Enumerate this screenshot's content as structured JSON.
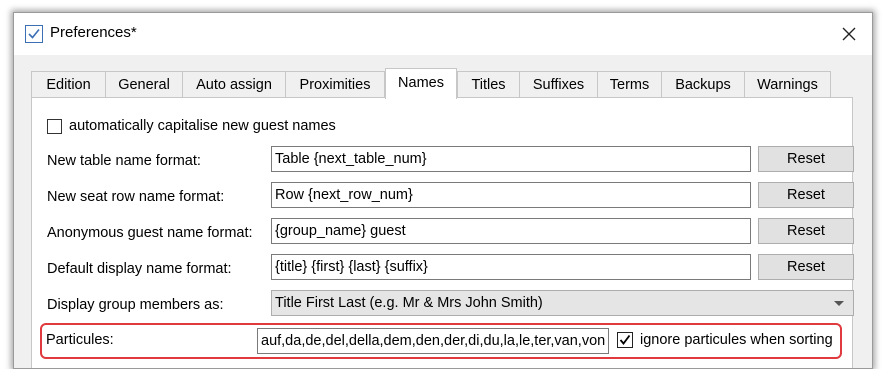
{
  "window": {
    "title": "Preferences*"
  },
  "tabs": [
    {
      "label": "Edition"
    },
    {
      "label": "General"
    },
    {
      "label": "Auto assign"
    },
    {
      "label": "Proximities"
    },
    {
      "label": "Names",
      "active": true
    },
    {
      "label": "Titles"
    },
    {
      "label": "Suffixes"
    },
    {
      "label": "Terms"
    },
    {
      "label": "Backups"
    },
    {
      "label": "Warnings"
    }
  ],
  "names": {
    "capitalise_label": "automatically capitalise new guest names",
    "capitalise_checked": false,
    "rows": [
      {
        "label": "New table name format:",
        "value": "Table {next_table_num}",
        "button": "Reset"
      },
      {
        "label": "New seat row name format:",
        "value": "Row {next_row_num}",
        "button": "Reset"
      },
      {
        "label": "Anonymous guest name format:",
        "value": "{group_name} guest",
        "button": "Reset"
      },
      {
        "label": "Default display name format:",
        "value": "{title} {first} {last} {suffix}",
        "button": "Reset"
      }
    ],
    "display_group_label": "Display group members as:",
    "display_group_value": "Title First Last (e.g. Mr & Mrs John Smith)",
    "particules_label": "Particules:",
    "particules_value": "auf,da,de,del,della,dem,den,der,di,du,la,le,ter,van,von",
    "ignore_label": "ignore particules when sorting",
    "ignore_checked": true
  },
  "colors": {
    "highlight": "#e0393e",
    "icon_blue": "#3c6fb4"
  }
}
